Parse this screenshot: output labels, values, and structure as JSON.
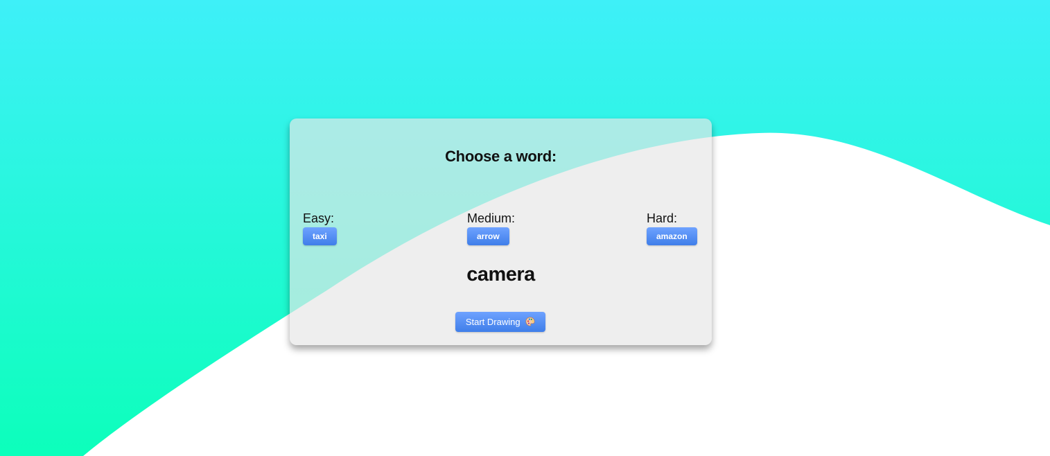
{
  "card": {
    "title": "Choose a word:",
    "levels": [
      {
        "label": "Easy:",
        "word": "taxi"
      },
      {
        "label": "Medium:",
        "word": "arrow"
      },
      {
        "label": "Hard:",
        "word": "amazon"
      }
    ],
    "selected_word": "camera",
    "start_button": {
      "label": "Start Drawing",
      "icon": "palette-icon"
    }
  },
  "colors": {
    "bg_top": "#3ef0f8",
    "bg_bottom": "#0cffbb",
    "button": "#4f8ff2",
    "card": "#eeeeee"
  }
}
